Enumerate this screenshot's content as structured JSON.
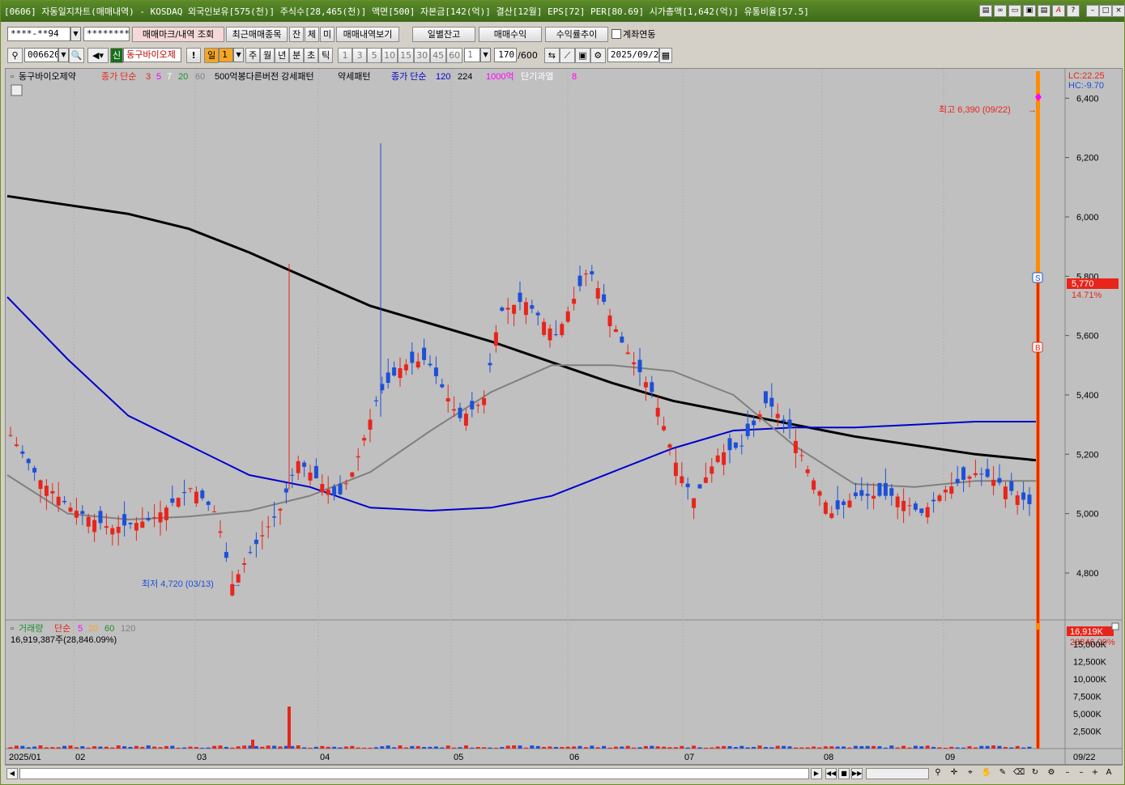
{
  "titlebar": {
    "title": "[0606] 자동일지차트(매매내역) - KOSDAQ 외국인보유[575(천)] 주식수[28,465(천)] 액면[500] 자본금[142(억)] 결산[12월] EPS[72] PER[80.69] 시가총액[1,642(억)] 유통비율[57.5]"
  },
  "toolbar1": {
    "account": "****-**94",
    "password": "*********",
    "mark_btn": "매매마크/내역 조회",
    "recent_btn": "최근매매종목",
    "jan_btn": "잔",
    "che_btn": "체",
    "mi_btn": "미",
    "history_btn": "매매내역보기",
    "daily_btn": "일별잔고",
    "profit_btn": "매매수익",
    "trend_btn": "수익률추이",
    "link_label": "계좌연동"
  },
  "toolbar2": {
    "code": "006620",
    "shin": "신",
    "name": "동구바이오제",
    "bang": "!",
    "period_sel": "일",
    "period_num": "1",
    "periods": [
      "주",
      "월",
      "년",
      "분",
      "초",
      "틱"
    ],
    "nums": [
      "1",
      "3",
      "5",
      "10",
      "15",
      "30",
      "45",
      "60"
    ],
    "count_sel": "1",
    "bar_count": "170",
    "bar_total": "/600",
    "date": "2025/09/22"
  },
  "legend_price": {
    "name": "동구바이오제약",
    "ma_label": "종가 단순",
    "ma1": "3",
    "ma2": "5",
    "ma3": "7",
    "ma4": "20",
    "ma5": "60",
    "pattern": "500억봉다른버전 강세패턴",
    "weak": "약세패턴",
    "ma_label2": "종가 단순",
    "ma6": "120",
    "ma7": "224",
    "amt": "1000억",
    "overheat": "단기과열",
    "overheat_n": "8"
  },
  "legend_volume": {
    "label": "거래량",
    "ma_label": "단순",
    "ma1": "5",
    "ma2": "20",
    "ma3": "60",
    "ma4": "120",
    "value": "16,919,387주(28,846.09%)"
  },
  "price_axis": {
    "lc": "LC:22.25",
    "hc": "HC:-9.70",
    "ticks": [
      "6,400",
      "6,200",
      "6,000",
      "5,800",
      "5,600",
      "5,400",
      "5,200",
      "5,000",
      "4,800"
    ],
    "current": "5,770",
    "change": "14.71%"
  },
  "volume_axis": {
    "current": "16,919K",
    "pct": "28846.09%",
    "ticks": [
      "15,000K",
      "12,500K",
      "10,000K",
      "7,500K",
      "5,000K",
      "2,500K"
    ]
  },
  "annotations": {
    "high": "최고 6,390 (09/22)",
    "low": "최저 4,720 (03/13)",
    "sell_mark": "S",
    "buy_mark": "B"
  },
  "x_axis": {
    "labels": [
      "2025/01",
      "02",
      "03",
      "04",
      "05",
      "06",
      "07",
      "08",
      "09"
    ],
    "right_date": "09/22"
  },
  "colors": {
    "up": "#e8251b",
    "down": "#1d50d8",
    "ma3": "#ff2020",
    "ma5": "#ff00ff",
    "ma7": "#ffffff",
    "ma20": "#1f8f2f",
    "ma60": "#808080",
    "ma120": "#0000cc",
    "ma224": "#000000",
    "highlight": "#ff8c00"
  },
  "chart_data": {
    "type": "candlestick",
    "series": [
      {
        "name": "종가 단순 224",
        "values": [
          6070,
          6040,
          6010,
          5960,
          5880,
          5790,
          5700,
          5640,
          5580,
          5510,
          5440,
          5380,
          5340,
          5300,
          5260,
          5230,
          5200,
          5180
        ]
      },
      {
        "name": "종가 단순 120",
        "values": [
          5730,
          5520,
          5330,
          5230,
          5130,
          5090,
          5020,
          5010,
          5020,
          5060,
          5140,
          5220,
          5280,
          5290,
          5290,
          5300,
          5310,
          5310
        ]
      },
      {
        "name": "종가 단순 60",
        "values": [
          5130,
          5000,
          4980,
          4990,
          5010,
          5060,
          5140,
          5280,
          5410,
          5500,
          5500,
          5480,
          5400,
          5230,
          5100,
          5090,
          5110,
          5110
        ]
      }
    ],
    "ylim": [
      4650,
      6450
    ]
  }
}
